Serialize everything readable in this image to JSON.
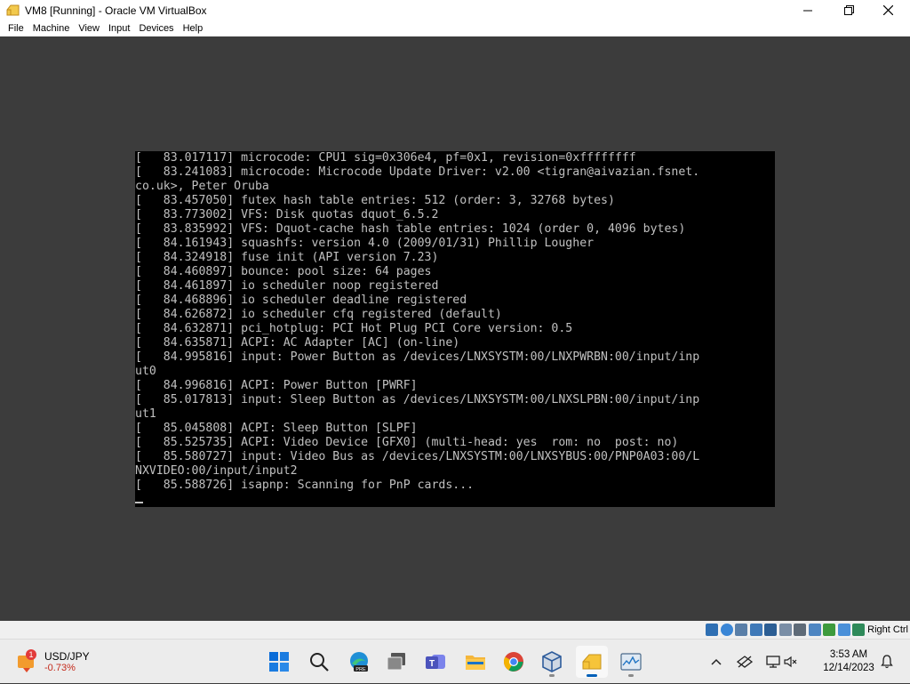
{
  "window": {
    "title": "VM8 [Running] - Oracle VM VirtualBox"
  },
  "menu": [
    {
      "label": "File"
    },
    {
      "label": "Machine"
    },
    {
      "label": "View"
    },
    {
      "label": "Input"
    },
    {
      "label": "Devices"
    },
    {
      "label": "Help"
    }
  ],
  "console": {
    "lines": [
      "[   83.017117] microcode: CPU1 sig=0x306e4, pf=0x1, revision=0xffffffff",
      "[   83.241083] microcode: Microcode Update Driver: v2.00 <tigran@aivazian.fsnet.",
      "co.uk>, Peter Oruba",
      "[   83.457050] futex hash table entries: 512 (order: 3, 32768 bytes)",
      "[   83.773002] VFS: Disk quotas dquot_6.5.2",
      "[   83.835992] VFS: Dquot-cache hash table entries: 1024 (order 0, 4096 bytes)",
      "[   84.161943] squashfs: version 4.0 (2009/01/31) Phillip Lougher",
      "[   84.324918] fuse init (API version 7.23)",
      "[   84.460897] bounce: pool size: 64 pages",
      "[   84.461897] io scheduler noop registered",
      "[   84.468896] io scheduler deadline registered",
      "[   84.626872] io scheduler cfq registered (default)",
      "[   84.632871] pci_hotplug: PCI Hot Plug PCI Core version: 0.5",
      "[   84.635871] ACPI: AC Adapter [AC] (on-line)",
      "[   84.995816] input: Power Button as /devices/LNXSYSTM:00/LNXPWRBN:00/input/inp",
      "ut0",
      "[   84.996816] ACPI: Power Button [PWRF]",
      "[   85.017813] input: Sleep Button as /devices/LNXSYSTM:00/LNXSLPBN:00/input/inp",
      "ut1",
      "[   85.045808] ACPI: Sleep Button [SLPF]",
      "[   85.525735] ACPI: Video Device [GFX0] (multi-head: yes  rom: no  post: no)",
      "[   85.580727] input: Video Bus as /devices/LNXSYSTM:00/LNXSYBUS:00/PNP0A03:00/L",
      "NXVIDEO:00/input/input2",
      "[   85.588726] isapnp: Scanning for PnP cards..."
    ],
    "cursor": "_"
  },
  "statusbar": {
    "host_key_label": "Right Ctrl",
    "icons": [
      "hard-disk-icon",
      "optical-drive-icon",
      "audio-icon",
      "network-icon",
      "usb-icon",
      "shared-folders-icon",
      "display-icon",
      "recording-icon",
      "cpu-icon",
      "mouse-integration-icon",
      "keyboard-icon"
    ]
  },
  "taskbar": {
    "widget": {
      "badge": "1",
      "symbol": "USD/JPY",
      "change": "-0.73%"
    },
    "apps": [
      {
        "name": "start"
      },
      {
        "name": "search"
      },
      {
        "name": "edge-preview",
        "badge": "PRE"
      },
      {
        "name": "task-view"
      },
      {
        "name": "teams"
      },
      {
        "name": "file-explorer"
      },
      {
        "name": "chrome"
      },
      {
        "name": "virtualbox"
      },
      {
        "name": "vm8-window"
      },
      {
        "name": "resource-monitor"
      }
    ],
    "clock": {
      "time": "3:53 AM",
      "date": "12/14/2023"
    }
  },
  "colors": {
    "vm_background": "#3c3c3c",
    "console_background": "#000000",
    "console_text": "#c0c0c0",
    "accent": "#005fb8",
    "negative": "#c42b1c"
  }
}
